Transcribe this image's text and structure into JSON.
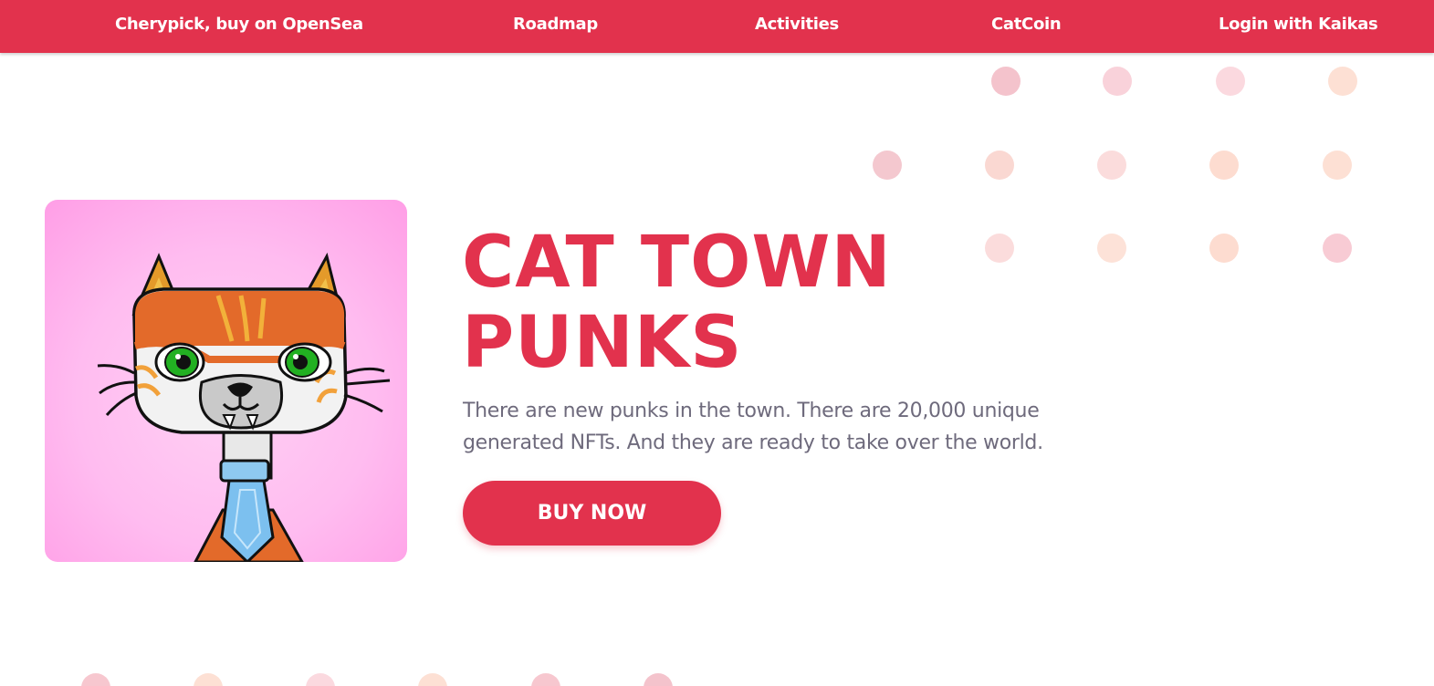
{
  "nav": {
    "items": [
      {
        "label": "Cherypick, buy on OpenSea"
      },
      {
        "label": "Roadmap"
      },
      {
        "label": "Activities"
      },
      {
        "label": "CatCoin"
      },
      {
        "label": "Login with Kaikas"
      }
    ]
  },
  "hero": {
    "title_line1": "CAT TOWN",
    "title_line2": "PUNKS",
    "description_line1": "There are new punks in the town. There are 20,000 unique",
    "description_line2": "generated NFTs. And they are ready to take over the world.",
    "buy_label": "BUY NOW",
    "image_icon": "cat-punk-nft-icon"
  },
  "colors": {
    "brand": "#e2324d",
    "text_muted": "#6e6a7c",
    "card_bg": "#ffbcf0",
    "dot_pink": "#f7c7cf",
    "dot_peach": "#fddccc"
  }
}
